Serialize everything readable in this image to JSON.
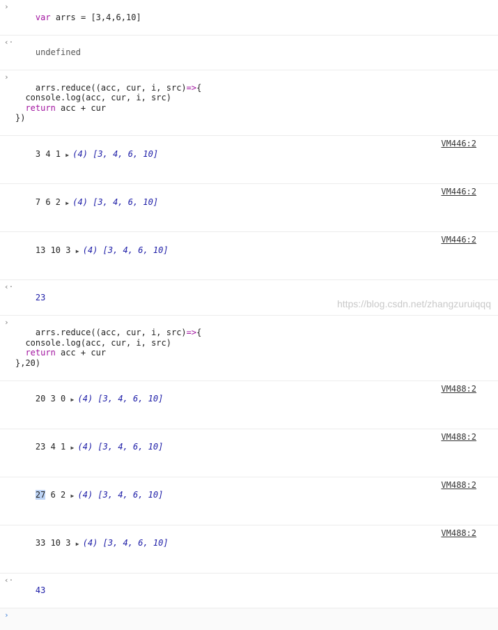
{
  "rows": [
    {
      "kind": "input",
      "gutter": "›",
      "lines": [
        [
          "var",
          "arrs",
          "=",
          "[3,4,6,10]"
        ]
      ]
    },
    {
      "kind": "echo",
      "gutter": "‹·",
      "text": "undefined"
    },
    {
      "kind": "input",
      "gutter": "›",
      "lines": [
        [
          "arrs.reduce((acc, cur, i, src)",
          "=>",
          "{"
        ],
        [
          "  console.log(acc, cur, i, src)"
        ],
        [
          "  ",
          "return",
          " acc + cur"
        ],
        [
          "})"
        ]
      ]
    },
    {
      "kind": "log",
      "prefix": "3 4 1",
      "array": "[3, 4, 6, 10]",
      "source": "VM446:2"
    },
    {
      "kind": "log",
      "prefix": "7 6 2",
      "array": "[3, 4, 6, 10]",
      "source": "VM446:2"
    },
    {
      "kind": "log",
      "prefix": "13 10 3",
      "array": "[3, 4, 6, 10]",
      "source": "VM446:2"
    },
    {
      "kind": "echo",
      "gutter": "‹·",
      "text": "23"
    },
    {
      "kind": "input",
      "gutter": "›",
      "lines": [
        [
          "arrs.reduce((acc, cur, i, src)",
          "=>",
          "{"
        ],
        [
          "  console.log(acc, cur, i, src)"
        ],
        [
          "  ",
          "return",
          " acc + cur"
        ],
        [
          "},20)"
        ]
      ]
    },
    {
      "kind": "log",
      "prefix": "20 3 0",
      "array": "[3, 4, 6, 10]",
      "source": "VM488:2"
    },
    {
      "kind": "log",
      "prefix": "23 4 1",
      "array": "[3, 4, 6, 10]",
      "source": "VM488:2"
    },
    {
      "kind": "log",
      "prefix": "27 6 2",
      "array": "[3, 4, 6, 10]",
      "source": "VM488:2",
      "selected": "27"
    },
    {
      "kind": "log",
      "prefix": "33 10 3",
      "array": "[3, 4, 6, 10]",
      "source": "VM488:2"
    },
    {
      "kind": "echo",
      "gutter": "‹·",
      "text": "43"
    }
  ],
  "array_length_label": "(4)",
  "prompt_symbol": "›",
  "watermark": "https://blog.csdn.net/zhangzuruiqqq"
}
